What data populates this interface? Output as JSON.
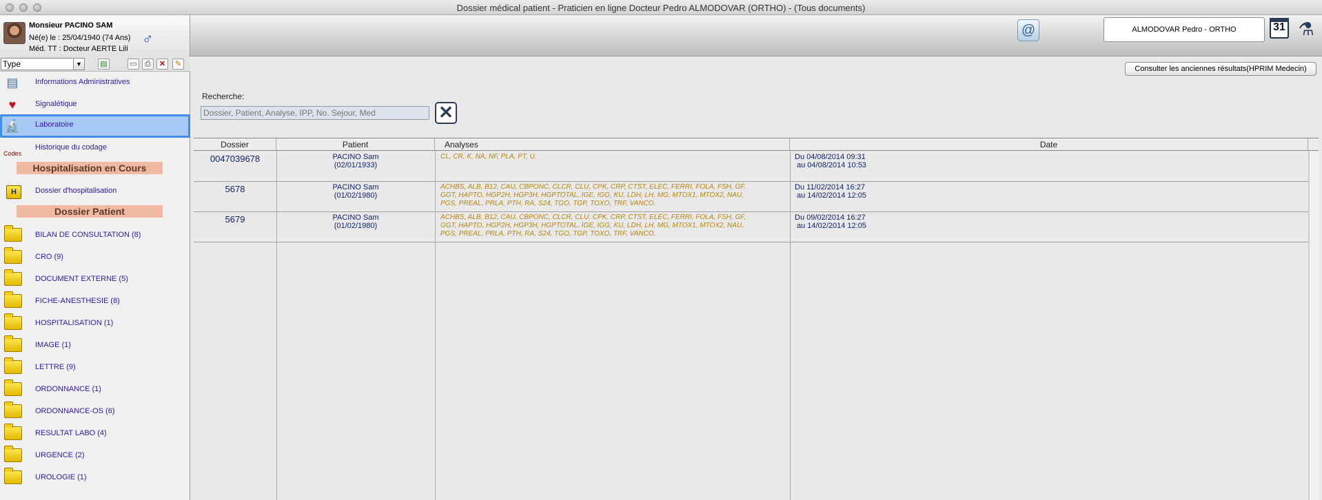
{
  "window": {
    "title": "Dossier médical patient - Praticien en ligne Docteur Pedro ALMODOVAR (ORTHO) - (Tous documents)"
  },
  "patient": {
    "name": "Monsieur PACINO SAM",
    "dob": "Né(e) le : 25/04/1940 (74 Ans)",
    "medecin_traitant": "Méd. TT : Docteur AERTE Lili"
  },
  "header": {
    "doctor": "ALMODOVAR Pedro - ORTHO",
    "calendar_day": "31"
  },
  "sidebar": {
    "type_select": "Type",
    "nav": [
      {
        "label": "Informations Administratives"
      },
      {
        "label": "Signalétique"
      },
      {
        "label": "Laboratoire"
      },
      {
        "label": "Historique du codage",
        "icon_text": "Codes"
      }
    ],
    "section_hospitalisation": "Hospitalisation en Cours",
    "hospitalisation_item": "Dossier d'hospitalisation",
    "hospitalisation_icon_text": "H",
    "section_dossier": "Dossier Patient",
    "folders": [
      "BILAN DE CONSULTATION (8)",
      "CRO (9)",
      "DOCUMENT EXTERNE (5)",
      "FICHE-ANESTHESIE (8)",
      "HOSPITALISATION (1)",
      "IMAGE (1)",
      "LETTRE (9)",
      "ORDONNANCE (1)",
      "ORDONNANCE-OS (6)",
      "RESULTAT LABO (4)",
      "URGENCE (2)",
      "UROLOGIE (1)"
    ]
  },
  "main": {
    "hprim_button": "Consulter les anciennes résultats(HPRIM Medecin)",
    "search_label": "Recherche:",
    "search_placeholder": "Dossier, Patient, Analyse, IPP, No. Sejour, Med",
    "columns": [
      "Dossier",
      "Patient",
      "Analyses",
      "Date"
    ],
    "rows": [
      {
        "dossier": "0047039678",
        "patient_name": "PACINO  Sam",
        "patient_dob": "(02/01/1933)",
        "analyses_lines": [
          "CL, CR, K, NA, NF, PLA, PT, U."
        ],
        "date_from": "Du 04/08/2014 09:31",
        "date_to": "au 04/08/2014 10:53"
      },
      {
        "dossier": "5678",
        "patient_name": "PACINO  Sam",
        "patient_dob": "(01/02/1980)",
        "analyses_lines": [
          "ACHBS, ALB, B12, CAU, CBPONC, CLCR, CLU, CPK, CRP, CTST, ELEC, FERRI, FOLA, FSH, GF,",
          "GGT, HAPTO, HGP2H, HGP3H, HGPTOTAL, IGE, IGG, KU, LDH, LH, MG, MTOX1, MTOX2, NAU,",
          "PGS, PREAL, PRLA, PTH, RA, S24, TGO, TGP, TOXO, TRF, VANCO."
        ],
        "date_from": "Du 11/02/2014 16:27",
        "date_to": "au 14/02/2014 12:05"
      },
      {
        "dossier": "5679",
        "patient_name": "PACINO  Sam",
        "patient_dob": "(01/02/1980)",
        "analyses_lines": [
          "ACHBS, ALB, B12, CAU, CBPONC, CLCR, CLU, CPK, CRP, CTST, ELEC, FERRI, FOLA, FSH, GF,",
          "GGT, HAPTO, HGP2H, HGP3H, HGPTOTAL, IGE, IGG, KU, LDH, LH, MG, MTOX1, MTOX2, NAU,",
          "PGS, PREAL, PRLA, PTH, RA, S24, TGO, TGP, TOXO, TRF, VANCO."
        ],
        "date_from": "Du 09/02/2014 16:27",
        "date_to": "au 14/02/2014 12:05"
      }
    ]
  },
  "colors": {
    "nav_text": "#2f1aa8",
    "selection": "#a8c8f5",
    "section_bg": "#f1b9a2",
    "analyses_text": "#b8860b",
    "table_text": "#13226e"
  }
}
